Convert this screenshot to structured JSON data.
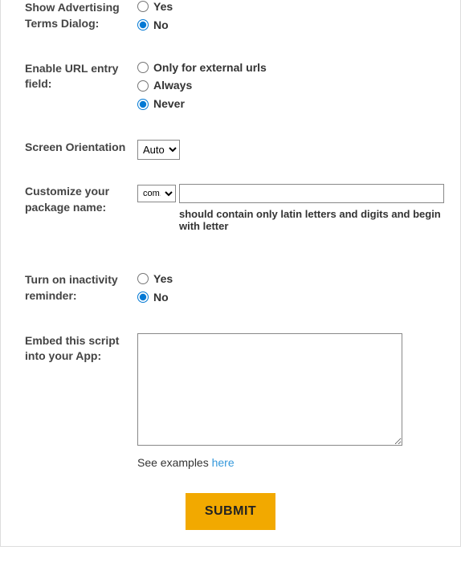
{
  "advertising": {
    "label": "Show Advertising Terms Dialog:",
    "options": {
      "yes": "Yes",
      "no": "No"
    },
    "selected": "no"
  },
  "url_entry": {
    "label": "Enable URL entry field:",
    "options": {
      "external": "Only for external urls",
      "always": "Always",
      "never": "Never"
    },
    "selected": "never"
  },
  "orientation": {
    "label": "Screen Orientation",
    "options": [
      "Auto"
    ],
    "selected": "Auto"
  },
  "package_name": {
    "label": "Customize your package name:",
    "prefix_options": [
      "com."
    ],
    "prefix_selected": "com.",
    "value": "",
    "hint": "should contain only latin letters and digits and begin with letter"
  },
  "inactivity": {
    "label": "Turn on inactivity reminder:",
    "options": {
      "yes": "Yes",
      "no": "No"
    },
    "selected": "no"
  },
  "embed_script": {
    "label": "Embed this script into your App:",
    "value": "",
    "examples_text": "See examples ",
    "examples_link": "here"
  },
  "submit": {
    "label": "SUBMIT"
  }
}
